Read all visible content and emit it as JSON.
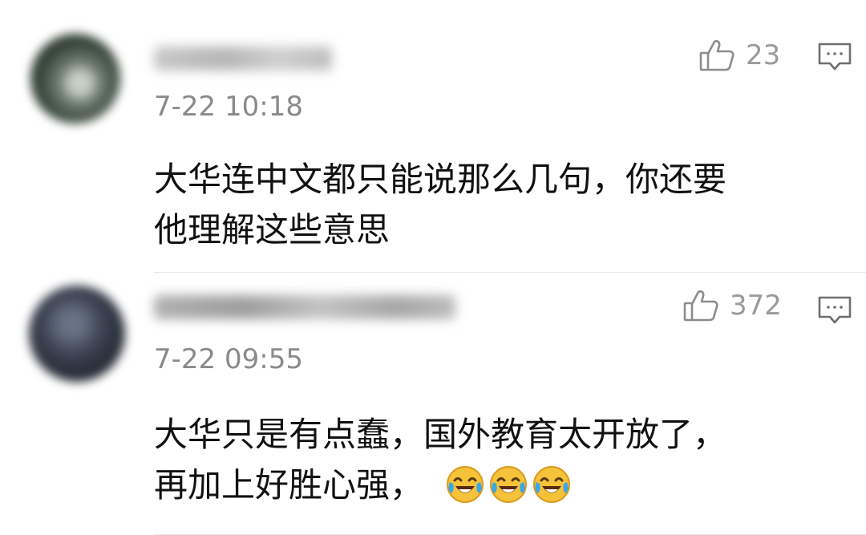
{
  "comments": [
    {
      "timestamp": "7-22 10:18",
      "likes": "23",
      "text_lines": [
        "大华连中文都只能说那么几句，你还要",
        "他理解这些意思"
      ],
      "icons": {
        "like": "thumbs-up-icon",
        "reply": "comment-bubble-icon"
      }
    },
    {
      "timestamp": "7-22 09:55",
      "likes": "372",
      "text_lines": [
        "大华只是有点蠢，国外教育太开放了，",
        "再加上好胜心强，"
      ],
      "emoji": [
        "crying-laughing-emoji",
        "crying-laughing-emoji",
        "crying-laughing-emoji"
      ],
      "icons": {
        "like": "thumbs-up-icon",
        "reply": "comment-bubble-icon"
      }
    }
  ],
  "colors": {
    "meta_text": "#8a8a8a",
    "body_text": "#111111",
    "icon_gray": "#8c8c8c",
    "emoji_yellow": "#f5c23a"
  }
}
